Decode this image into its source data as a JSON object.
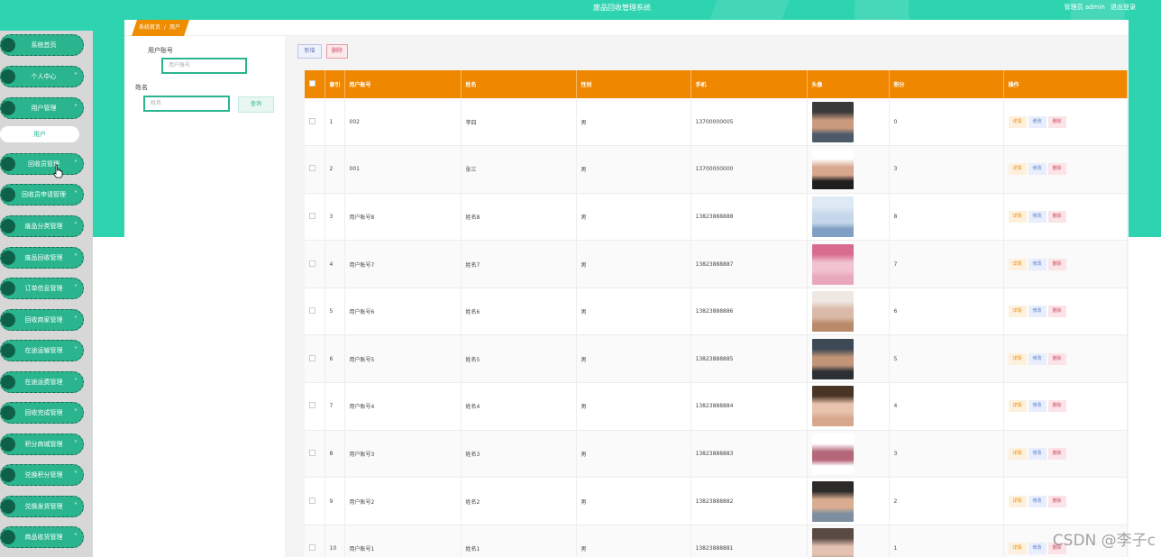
{
  "header": {
    "title": "废品回收管理系统",
    "user_label": "管理员 admin",
    "logout_label": "退出登录"
  },
  "colors": {
    "header_bg": "#2ed3b0",
    "nav_bg": "#2ab58f",
    "accent_orange": "#ef8700"
  },
  "sidebar": {
    "items": [
      {
        "label": "系统首页",
        "icon": "none"
      },
      {
        "label": "个人中心",
        "icon": "chevron-down-icon"
      },
      {
        "label": "用户管理",
        "icon": "chevron-up-icon"
      },
      {
        "label": "回收员管理",
        "icon": "chevron-down-icon"
      },
      {
        "label": "回收员申请管理",
        "icon": "chevron-down-icon"
      },
      {
        "label": "废品分类管理",
        "icon": "chevron-down-icon"
      },
      {
        "label": "废品回收管理",
        "icon": "chevron-down-icon"
      },
      {
        "label": "订单信息管理",
        "icon": "chevron-down-icon"
      },
      {
        "label": "回收商家管理",
        "icon": "chevron-down-icon"
      },
      {
        "label": "在途运输管理",
        "icon": "chevron-down-icon"
      },
      {
        "label": "在途运费管理",
        "icon": "chevron-down-icon"
      },
      {
        "label": "回收完成管理",
        "icon": "chevron-down-icon"
      },
      {
        "label": "积分商城管理",
        "icon": "chevron-down-icon"
      },
      {
        "label": "兑换积分管理",
        "icon": "chevron-down-icon"
      },
      {
        "label": "兑换发货管理",
        "icon": "chevron-down-icon"
      },
      {
        "label": "商品收货管理",
        "icon": "chevron-down-icon"
      }
    ],
    "subitem": "用户"
  },
  "breadcrumb": {
    "home": "系统首页",
    "sep": "/",
    "current": "用户"
  },
  "search": {
    "account_label": "用户账号",
    "account_placeholder": "用户账号",
    "name_label": "姓名",
    "name_placeholder": "姓名",
    "search_button": "查询"
  },
  "toolbar": {
    "add_label": "新增",
    "delete_label": "删除"
  },
  "table": {
    "headers": [
      "",
      "索引",
      "用户账号",
      "姓名",
      "性别",
      "手机",
      "头像",
      "积分",
      "操作"
    ],
    "op_labels": {
      "detail": "详情",
      "edit": "修改",
      "delete": "删除"
    },
    "rows": [
      {
        "index": "1",
        "account": "002",
        "name": "李四",
        "gender": "男",
        "phone": "13700000005",
        "points": "0",
        "avatar": {
          "top": "#3a3a3a",
          "mid": "#c99a7e",
          "bot": "#4c5a6a"
        }
      },
      {
        "index": "2",
        "account": "001",
        "name": "张三",
        "gender": "男",
        "phone": "13700000000",
        "points": "3",
        "avatar": {
          "top": "#ffffff",
          "mid": "#d8a88e",
          "bot": "#1f1f1f"
        }
      },
      {
        "index": "3",
        "account": "用户账号8",
        "name": "姓名8",
        "gender": "男",
        "phone": "13823888888",
        "points": "8",
        "avatar": {
          "top": "#dfe9f3",
          "mid": "#c5d7ea",
          "bot": "#7fa0c4"
        }
      },
      {
        "index": "4",
        "account": "用户账号7",
        "name": "姓名7",
        "gender": "男",
        "phone": "13823888887",
        "points": "7",
        "avatar": {
          "top": "#d96b8f",
          "mid": "#f1c2cf",
          "bot": "#e9a7bb"
        }
      },
      {
        "index": "5",
        "account": "用户账号6",
        "name": "姓名6",
        "gender": "男",
        "phone": "13823888886",
        "points": "6",
        "avatar": {
          "top": "#efe7e2",
          "mid": "#d9b9a8",
          "bot": "#b98a6a"
        }
      },
      {
        "index": "6",
        "account": "用户账号5",
        "name": "姓名5",
        "gender": "男",
        "phone": "13823888885",
        "points": "5",
        "avatar": {
          "top": "#3d4a55",
          "mid": "#c29478",
          "bot": "#2c3036"
        }
      },
      {
        "index": "7",
        "account": "用户账号4",
        "name": "姓名4",
        "gender": "男",
        "phone": "13823888884",
        "points": "4",
        "avatar": {
          "top": "#4a3426",
          "mid": "#e8c4ae",
          "bot": "#d7a78e"
        }
      },
      {
        "index": "8",
        "account": "用户账号3",
        "name": "姓名3",
        "gender": "男",
        "phone": "13823888883",
        "points": "3",
        "avatar": {
          "top": "#ffffff",
          "mid": "#b5677a",
          "bot": "#ffffff"
        }
      },
      {
        "index": "9",
        "account": "用户账号2",
        "name": "姓名2",
        "gender": "男",
        "phone": "13823888882",
        "points": "2",
        "avatar": {
          "top": "#2d2b2a",
          "mid": "#d9ad92",
          "bot": "#7c8ea0"
        }
      },
      {
        "index": "10",
        "account": "用户账号1",
        "name": "姓名1",
        "gender": "男",
        "phone": "13823888881",
        "points": "1",
        "avatar": {
          "top": "#5a4a44",
          "mid": "#e4c2b1",
          "bot": "#9f8a7c"
        }
      }
    ]
  },
  "watermark": "CSDN @李子c"
}
